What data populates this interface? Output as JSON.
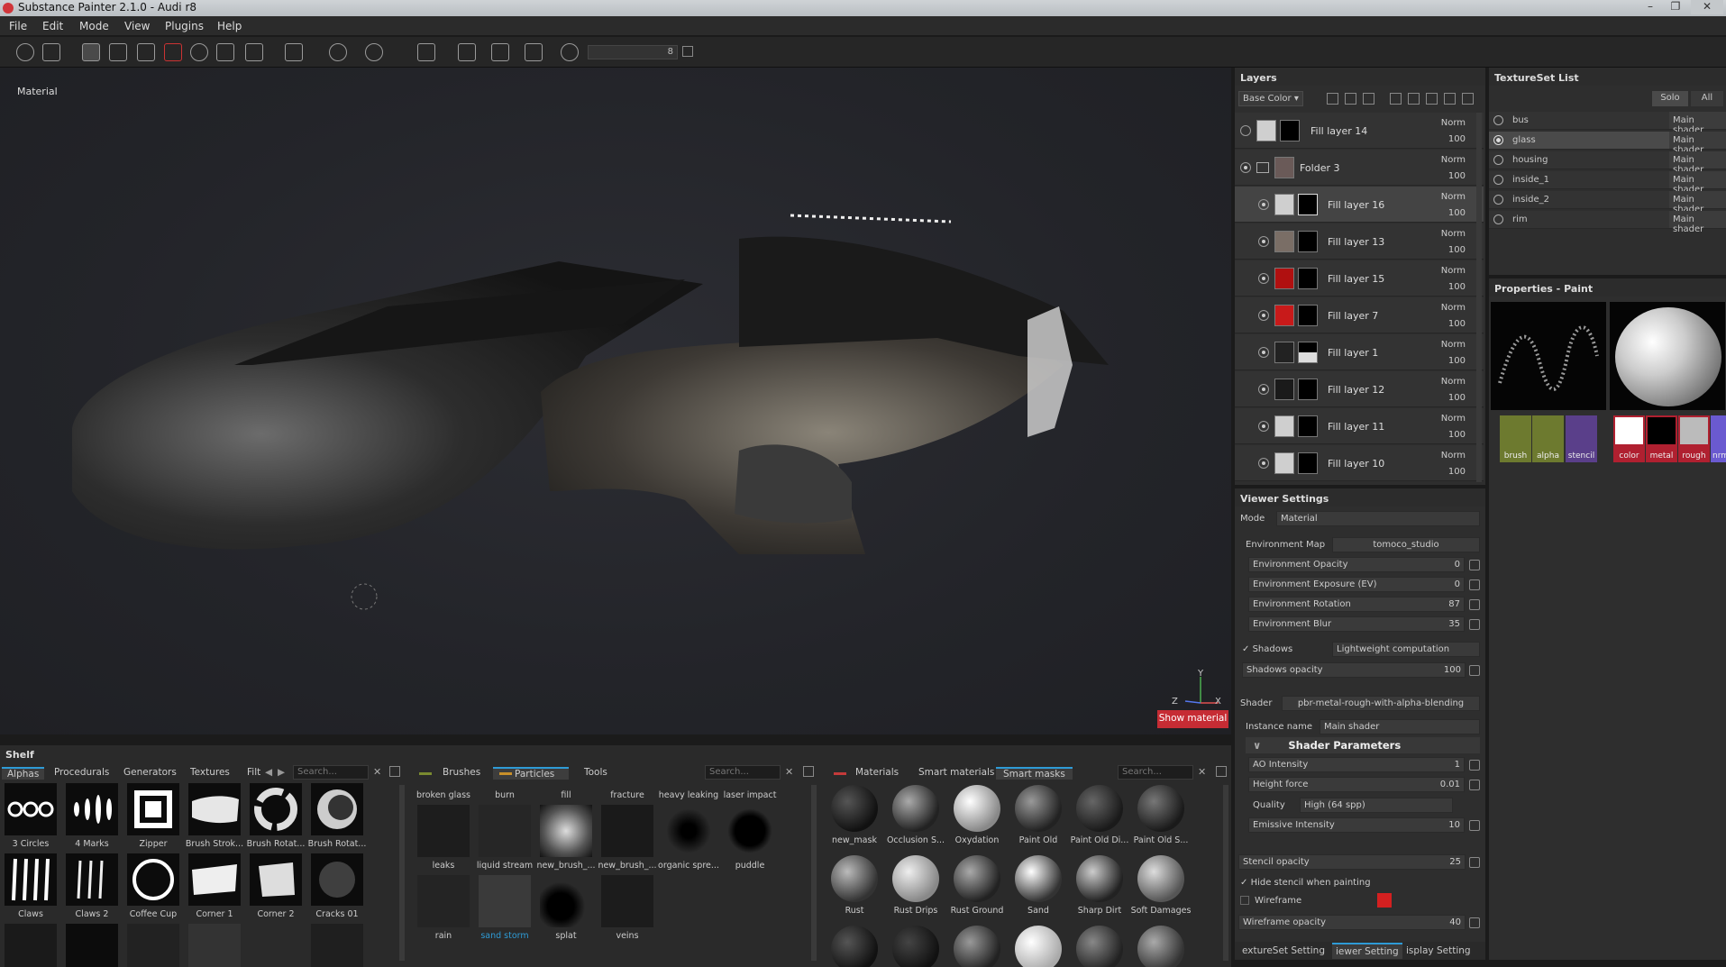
{
  "window": {
    "title": "Substance Painter 2.1.0 - Audi r8"
  },
  "menu": [
    "File",
    "Edit",
    "Mode",
    "View",
    "Plugins",
    "Help"
  ],
  "toolbar": {
    "size_value": "8"
  },
  "viewport": {
    "mode_label": "Material",
    "show_material_label": "Show material",
    "axis_y": "Y",
    "axis_z": "Z",
    "axis_x": "X"
  },
  "layers": {
    "title": "Layers",
    "channel": "Base Color",
    "items": [
      {
        "name": "Fill layer 14",
        "blend": "Norm",
        "opacity": "100",
        "thumb": "#cfcfcf"
      },
      {
        "name": "Folder 3",
        "blend": "Norm",
        "opacity": "100",
        "thumb": "#6a5a58"
      },
      {
        "name": "Fill layer 16",
        "blend": "Norm",
        "opacity": "100",
        "thumb": "#cfcfcf"
      },
      {
        "name": "Fill layer 13",
        "blend": "Norm",
        "opacity": "100",
        "thumb": "#7a6e66"
      },
      {
        "name": "Fill layer 15",
        "blend": "Norm",
        "opacity": "100",
        "thumb": "#b01010"
      },
      {
        "name": "Fill layer 7",
        "blend": "Norm",
        "opacity": "100",
        "thumb": "#c81a1a"
      },
      {
        "name": "Fill layer 1",
        "blend": "Norm",
        "opacity": "100",
        "thumb": "#222222"
      },
      {
        "name": "Fill layer 12",
        "blend": "Norm",
        "opacity": "100",
        "thumb": "#1a1a1a"
      },
      {
        "name": "Fill layer 11",
        "blend": "Norm",
        "opacity": "100",
        "thumb": "#cfcfcf"
      },
      {
        "name": "Fill layer 10",
        "blend": "Norm",
        "opacity": "100",
        "thumb": "#cfcfcf"
      }
    ]
  },
  "viewer_settings": {
    "title": "Viewer Settings",
    "mode_label": "Mode",
    "mode_value": "Material",
    "env_map_label": "Environment Map",
    "env_map_value": "tomoco_studio",
    "sliders": [
      {
        "label": "Environment Opacity",
        "value": "0"
      },
      {
        "label": "Environment Exposure (EV)",
        "value": "0"
      },
      {
        "label": "Environment Rotation",
        "value": "87"
      },
      {
        "label": "Environment Blur",
        "value": "35"
      }
    ],
    "shadows_label": "Shadows",
    "shadows_value": "Lightweight computation",
    "shadows_opacity_label": "Shadows opacity",
    "shadows_opacity_value": "100",
    "shader_label": "Shader",
    "shader_value": "pbr-metal-rough-with-alpha-blending",
    "instance_label": "Instance name",
    "instance_value": "Main shader",
    "shader_params_title": "Shader Parameters",
    "ao_label": "AO Intensity",
    "ao_value": "1",
    "height_label": "Height force",
    "height_value": "0.01",
    "quality_label": "Quality",
    "quality_value": "High (64 spp)",
    "emissive_label": "Emissive Intensity",
    "emissive_value": "10",
    "stencil_label": "Stencil opacity",
    "stencil_value": "25",
    "hide_stencil_label": "Hide stencil when painting",
    "wireframe_label": "Wireframe",
    "wireframe_opacity_label": "Wireframe opacity",
    "wireframe_opacity_value": "40",
    "wireframe_color": "#d42020"
  },
  "bottom_tabs": [
    "extureSet Setting",
    "iewer Setting",
    "isplay Setting"
  ],
  "texture_set": {
    "title": "TextureSet List",
    "solo": "Solo",
    "all": "All",
    "items": [
      {
        "name": "bus",
        "shader": "Main shader"
      },
      {
        "name": "glass",
        "shader": "Main shader"
      },
      {
        "name": "housing",
        "shader": "Main shader"
      },
      {
        "name": "inside_1",
        "shader": "Main shader"
      },
      {
        "name": "inside_2",
        "shader": "Main shader"
      },
      {
        "name": "rim",
        "shader": "Main shader"
      }
    ]
  },
  "properties": {
    "title": "Properties - Paint",
    "slots_left": [
      "brush",
      "alpha",
      "stencil"
    ],
    "slots_right": [
      "color",
      "metal",
      "rough",
      "nrm"
    ]
  },
  "shelf": {
    "title": "Shelf",
    "left_tabs": [
      "Alphas",
      "Procedurals",
      "Generators",
      "Textures",
      "Filt"
    ],
    "left_search": "Search...",
    "alphas": [
      "3 Circles",
      "4 Marks",
      "Zipper",
      "Brush Strok...",
      "Brush Rotat...",
      "Brush Rotat...",
      "Claws",
      "Claws 2",
      "Coffee Cup",
      "Corner 1",
      "Corner 2",
      "Cracks 01"
    ],
    "mid_tabs": [
      "Brushes",
      "Particles",
      "Tools"
    ],
    "mid_search": "Search...",
    "particles": [
      "broken glass",
      "burn",
      "fill",
      "fracture",
      "heavy leaking",
      "laser impact",
      "leaks",
      "liquid stream",
      "new_brush_...",
      "new_brush_...",
      "organic spre...",
      "puddle",
      "rain",
      "sand storm",
      "splat",
      "veins"
    ],
    "right_tabs": [
      "Materials",
      "Smart materials",
      "Smart masks"
    ],
    "right_search": "Search...",
    "masks": [
      "new_mask",
      "Occlusion S...",
      "Oxydation",
      "Paint Old",
      "Paint Old Di...",
      "Paint Old S...",
      "Rust",
      "Rust Drips",
      "Rust Ground",
      "Sand",
      "Sharp Dirt",
      "Soft Damages"
    ]
  }
}
